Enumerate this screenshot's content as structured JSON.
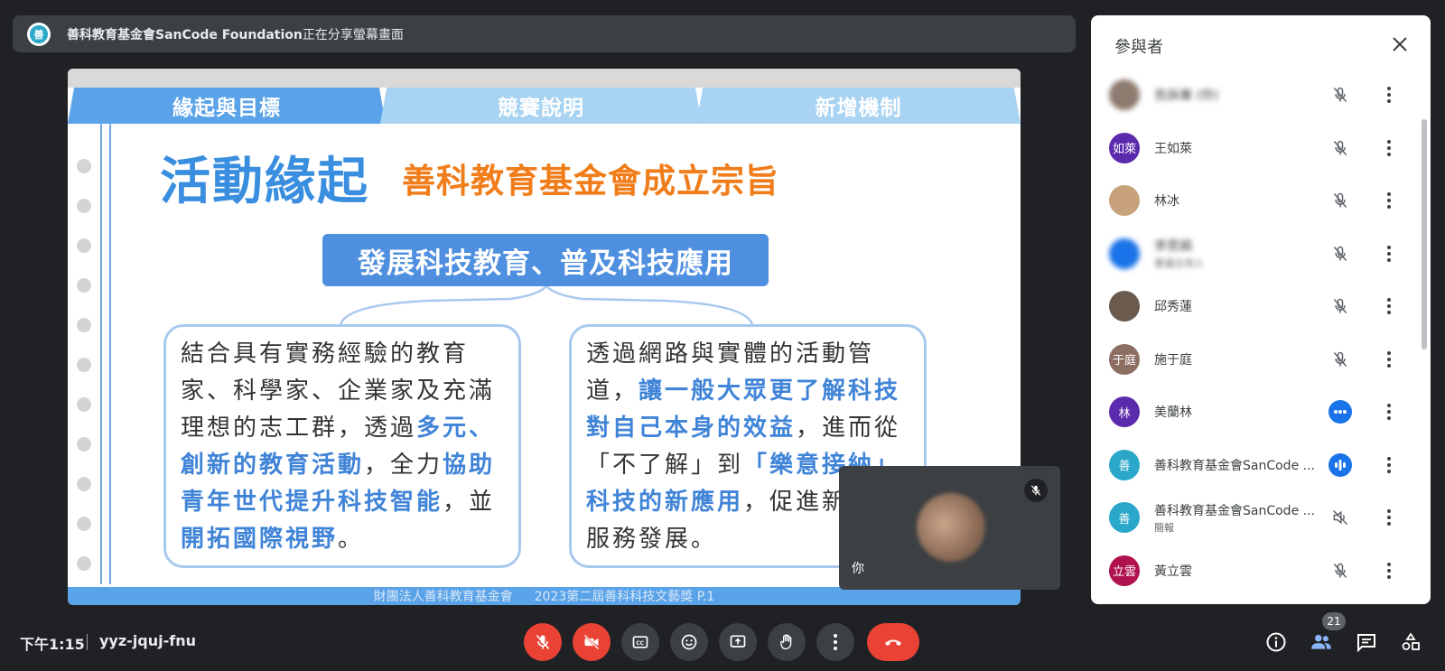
{
  "share_banner": {
    "presenter": "善科教育基金會SanCode Foundation",
    "suffix": "正在分享螢幕畫面"
  },
  "slide": {
    "tabs": [
      "緣起與目標",
      "競賽說明",
      "新增機制"
    ],
    "title": "活動緣起",
    "subtitle": "善科教育基金會成立宗旨",
    "pill": "發展科技教育、普及科技應用",
    "box_left": {
      "p1": "結合具有實務經驗的教育家、科學家、企業家及充滿理想的志工群，透過",
      "h1": "多元、創新的教育活動",
      "p2": "，全力",
      "h2": "協助青年世代提升科技智能",
      "p3": "，並",
      "h3": "開拓國際視野",
      "p4": "。"
    },
    "box_right": {
      "p1": "透過網路與實體的活動管道，",
      "h1": "讓一般大眾更了解科技對自己本身的效益",
      "p2": "，進而從「不了解」到",
      "h2": "「樂意接納」科技的新應用",
      "p3": "，促進新科技服務發展。"
    },
    "footer_org": "財團法人善科教育基金會",
    "footer_event": "2023第二屆善科科技文藝獎 P.1"
  },
  "self_tile": {
    "name": "你"
  },
  "panel": {
    "title": "參與者",
    "participants": [
      {
        "name": "告訴兼 (你)",
        "sub": "",
        "avatar_text": "",
        "avatar_color": "#8d7b6f",
        "status": "muted",
        "blurred": true
      },
      {
        "name": "王如萊",
        "sub": "",
        "avatar_text": "如萊",
        "avatar_color": "#5b2bad",
        "status": "muted",
        "blurred": false
      },
      {
        "name": "林冰",
        "sub": "",
        "avatar_text": "",
        "avatar_color": "#c8a27a",
        "status": "muted",
        "blurred": false
      },
      {
        "name": "李思娟",
        "sub": "會議主持人",
        "avatar_text": "",
        "avatar_color": "#1a73e8",
        "status": "muted",
        "blurred": true
      },
      {
        "name": "邱秀蓮",
        "sub": "",
        "avatar_text": "",
        "avatar_color": "#6b5a4e",
        "status": "muted",
        "blurred": false
      },
      {
        "name": "施于庭",
        "sub": "",
        "avatar_text": "于庭",
        "avatar_color": "#8d6e63",
        "status": "muted",
        "blurred": false
      },
      {
        "name": "美蘭林",
        "sub": "",
        "avatar_text": "林",
        "avatar_color": "#5b2bad",
        "status": "idle",
        "blurred": false
      },
      {
        "name": "善科教育基金會SanCode ...",
        "sub": "",
        "avatar_text": "善",
        "avatar_color": "#2aa7c9",
        "status": "speaking",
        "blurred": false
      },
      {
        "name": "善科教育基金會SanCode ...",
        "sub": "簡報",
        "avatar_text": "善",
        "avatar_color": "#2aa7c9",
        "status": "volume-off",
        "blurred": false
      },
      {
        "name": "黃立雲",
        "sub": "",
        "avatar_text": "立雲",
        "avatar_color": "#b0124f",
        "status": "muted",
        "blurred": false
      }
    ],
    "participant_count": "21"
  },
  "bottom": {
    "clock": "下午1:15",
    "meeting_code": "yyz-jquj-fnu"
  },
  "icons": {
    "mic_off": "mic-off-icon",
    "camera_off": "camera-off-icon",
    "captions": "captions-icon",
    "emoji": "emoji-icon",
    "present": "present-screen-icon",
    "raise_hand": "raise-hand-icon",
    "more": "more-options-icon",
    "end_call": "end-call-icon",
    "info": "info-icon",
    "people": "people-icon",
    "chat": "chat-icon",
    "activities": "activities-icon"
  },
  "colors": {
    "accent_red": "#ea4335",
    "meet_dark": "#202124",
    "meet_gray": "#3c4043",
    "slide_blue": "#3a8ee0",
    "slide_orange": "#f07d1a"
  }
}
